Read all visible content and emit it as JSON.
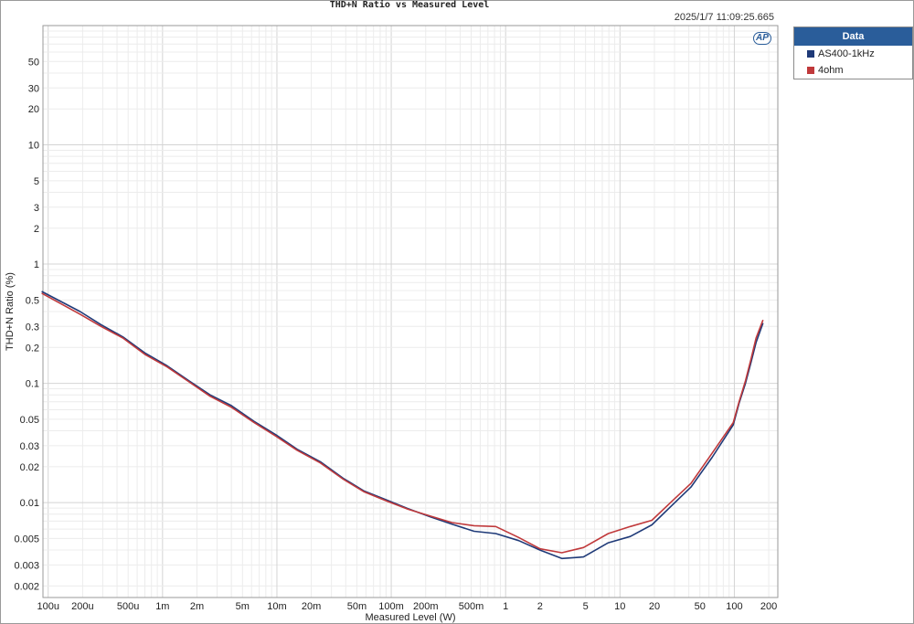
{
  "timestamp": "2025/1/7 11:09:25.665",
  "logo_text": "AP",
  "legend": {
    "title": "Data",
    "items": [
      {
        "label": "AS400-1kHz",
        "color": "#1f3a78"
      },
      {
        "label": "4ohm",
        "color": "#c0393b"
      }
    ]
  },
  "chart_data": {
    "type": "line",
    "title": "THD+N Ratio vs Measured Level",
    "xlabel": "Measured Level (W)",
    "ylabel": "THD+N Ratio (%)",
    "x_scale": "log",
    "y_scale": "log",
    "xlim": [
      9e-05,
      240
    ],
    "ylim": [
      0.0016,
      100
    ],
    "grid": true,
    "legend_position": "right-outside",
    "x_ticks": [
      {
        "value": 0.0001,
        "label": "100u"
      },
      {
        "value": 0.0002,
        "label": "200u"
      },
      {
        "value": 0.0005,
        "label": "500u"
      },
      {
        "value": 0.001,
        "label": "1m"
      },
      {
        "value": 0.002,
        "label": "2m"
      },
      {
        "value": 0.005,
        "label": "5m"
      },
      {
        "value": 0.01,
        "label": "10m"
      },
      {
        "value": 0.02,
        "label": "20m"
      },
      {
        "value": 0.05,
        "label": "50m"
      },
      {
        "value": 0.1,
        "label": "100m"
      },
      {
        "value": 0.2,
        "label": "200m"
      },
      {
        "value": 0.5,
        "label": "500m"
      },
      {
        "value": 1,
        "label": "1"
      },
      {
        "value": 2,
        "label": "2"
      },
      {
        "value": 5,
        "label": "5"
      },
      {
        "value": 10,
        "label": "10"
      },
      {
        "value": 20,
        "label": "20"
      },
      {
        "value": 50,
        "label": "50"
      },
      {
        "value": 100,
        "label": "100"
      },
      {
        "value": 200,
        "label": "200"
      }
    ],
    "y_ticks": [
      {
        "value": 0.002,
        "label": "0.002"
      },
      {
        "value": 0.003,
        "label": "0.003"
      },
      {
        "value": 0.005,
        "label": "0.005"
      },
      {
        "value": 0.01,
        "label": "0.01"
      },
      {
        "value": 0.02,
        "label": "0.02"
      },
      {
        "value": 0.03,
        "label": "0.03"
      },
      {
        "value": 0.05,
        "label": "0.05"
      },
      {
        "value": 0.1,
        "label": "0.1"
      },
      {
        "value": 0.2,
        "label": "0.2"
      },
      {
        "value": 0.3,
        "label": "0.3"
      },
      {
        "value": 0.5,
        "label": "0.5"
      },
      {
        "value": 1,
        "label": "1"
      },
      {
        "value": 2,
        "label": "2"
      },
      {
        "value": 3,
        "label": "3"
      },
      {
        "value": 5,
        "label": "5"
      },
      {
        "value": 10,
        "label": "10"
      },
      {
        "value": 20,
        "label": "20"
      },
      {
        "value": 30,
        "label": "30"
      },
      {
        "value": 50,
        "label": "50"
      }
    ],
    "series": [
      {
        "name": "AS400-1kHz",
        "color": "#1f3a78",
        "x": [
          8.77e-05,
          0.00019,
          0.00029,
          0.00045,
          0.0007,
          0.0011,
          0.0017,
          0.0026,
          0.004,
          0.0063,
          0.0098,
          0.015,
          0.024,
          0.038,
          0.058,
          0.091,
          0.14,
          0.22,
          0.34,
          0.53,
          0.82,
          1.3,
          2.0,
          3.1,
          4.8,
          7.9,
          12.3,
          19,
          29.5,
          41.8,
          64,
          98,
          110,
          125,
          140,
          155,
          178
        ],
        "y": [
          0.59,
          0.4,
          0.31,
          0.245,
          0.18,
          0.14,
          0.105,
          0.08,
          0.065,
          0.048,
          0.037,
          0.028,
          0.022,
          0.016,
          0.0125,
          0.0105,
          0.0089,
          0.0076,
          0.0066,
          0.00575,
          0.0055,
          0.0048,
          0.004,
          0.0034,
          0.0035,
          0.0046,
          0.0052,
          0.0065,
          0.0098,
          0.0135,
          0.024,
          0.045,
          0.068,
          0.1,
          0.15,
          0.22,
          0.32
        ]
      },
      {
        "name": "4ohm",
        "color": "#c0393b",
        "x": [
          8.77e-05,
          0.00019,
          0.00029,
          0.00045,
          0.0007,
          0.0011,
          0.0017,
          0.0026,
          0.004,
          0.0063,
          0.0098,
          0.015,
          0.024,
          0.038,
          0.058,
          0.091,
          0.14,
          0.22,
          0.34,
          0.53,
          0.82,
          1.3,
          2.0,
          3.1,
          4.8,
          7.9,
          12.3,
          19,
          29.5,
          41.8,
          64,
          98,
          110,
          125,
          140,
          155,
          178
        ],
        "y": [
          0.57,
          0.38,
          0.3,
          0.24,
          0.175,
          0.137,
          0.103,
          0.078,
          0.063,
          0.047,
          0.036,
          0.0275,
          0.0215,
          0.0157,
          0.0123,
          0.0103,
          0.0088,
          0.0077,
          0.0068,
          0.0064,
          0.0063,
          0.0051,
          0.0041,
          0.0038,
          0.0042,
          0.0055,
          0.0063,
          0.0071,
          0.0106,
          0.0145,
          0.026,
          0.047,
          0.07,
          0.105,
          0.16,
          0.24,
          0.34
        ]
      }
    ]
  }
}
